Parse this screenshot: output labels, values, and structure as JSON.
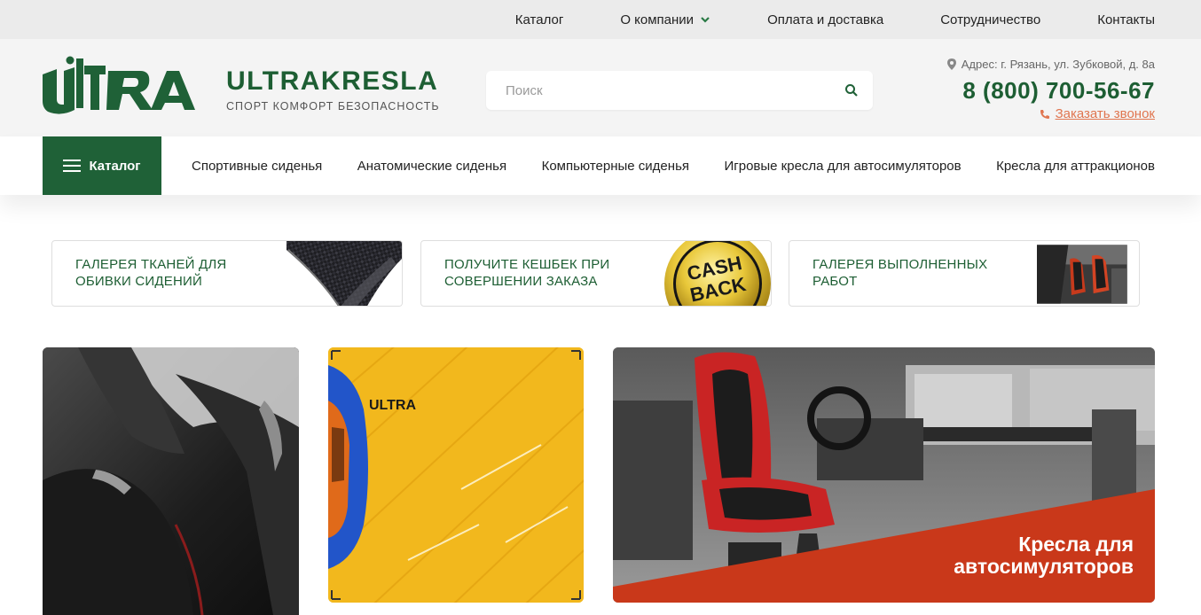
{
  "top_nav": {
    "items": [
      "Каталог",
      "О компании",
      "Оплата и доставка",
      "Сотрудничество",
      "Контакты"
    ]
  },
  "header": {
    "logo_text": "ULTRA",
    "brand_name": "ULTRAKRESLA",
    "tagline": "СПОРТ КОМФОРТ БЕЗОПАСНОСТЬ",
    "search_placeholder": "Поиск",
    "address": "Адрес: г. Рязань, ул. Зубковой, д. 8а",
    "phone": "8 (800) 700-56-67",
    "callback_label": "Заказать звонок"
  },
  "main_nav": {
    "catalog_button": "Каталог",
    "items": [
      "Спортивные сиденья",
      "Анатомические сиденья",
      "Компьютерные сиденья",
      "Игровые кресла для автосимуляторов",
      "Кресла для аттракционов"
    ]
  },
  "promos": [
    {
      "text": "ГАЛЕРЕЯ ТКАНЕЙ ДЛЯ ОБИВКИ СИДЕНИЙ"
    },
    {
      "text": "ПОЛУЧИТЕ КЕШБЕК ПРИ СОВЕРШЕНИИ ЗАКАЗА",
      "badge_top": "CASH",
      "badge_bottom": "BACK"
    },
    {
      "text": "ГАЛЕРЕЯ ВЫПОЛНЕННЫХ РАБОТ"
    }
  ],
  "banners": {
    "middle_logo": "ULTRA",
    "right_caption_line1": "Кресла для",
    "right_caption_line2": "автосимуляторов"
  },
  "colors": {
    "brand_green": "#1d5e33",
    "catalog_green": "#1f6137",
    "accent_orange": "#e0754f",
    "banner_red": "#c9381a",
    "banner_yellow": "#f2b81d"
  }
}
